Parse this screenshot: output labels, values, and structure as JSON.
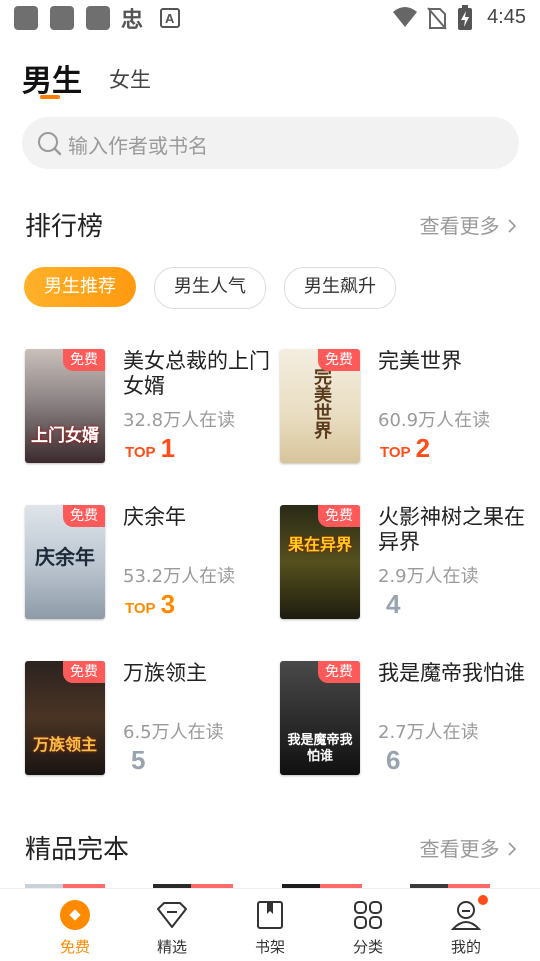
{
  "status_bar": {
    "time": "4:45",
    "app_glyph": "忠",
    "icons": [
      "app-square-icon",
      "app-square-icon",
      "app-square-icon",
      "font-app-icon",
      "wifi-icon",
      "no-sim-icon",
      "battery-charging-icon"
    ]
  },
  "tabs": {
    "male": "男生",
    "female": "女生"
  },
  "search": {
    "placeholder": "输入作者或书名"
  },
  "ranking": {
    "title": "排行榜",
    "more": "查看更多",
    "filters": [
      "男生推荐",
      "男生人气",
      "男生飙升"
    ],
    "books": [
      {
        "title": "美女总裁的上门女婿",
        "readers": "32.8万人在读",
        "top_label": "TOP",
        "rank": "1",
        "badge": "免费",
        "cover_text": "上门女婿",
        "accent": "#ff4d1a"
      },
      {
        "title": "完美世界",
        "readers": "60.9万人在读",
        "top_label": "TOP",
        "rank": "2",
        "badge": "免费",
        "cover_text": "完美世界",
        "accent": "#ff4d1a"
      },
      {
        "title": "庆余年",
        "readers": "53.2万人在读",
        "top_label": "TOP",
        "rank": "3",
        "badge": "免费",
        "cover_text": "庆余年",
        "accent": "#ff8a00"
      },
      {
        "title": "火影神树之果在异界",
        "readers": "2.9万人在读",
        "top_label": "",
        "rank": "4",
        "badge": "免费",
        "cover_text": "果在异界",
        "accent": "#9aa3b0"
      },
      {
        "title": "万族领主",
        "readers": "6.5万人在读",
        "top_label": "",
        "rank": "5",
        "badge": "免费",
        "cover_text": "万族领主",
        "accent": "#9aa3b0"
      },
      {
        "title": "我是魔帝我怕谁",
        "readers": "2.7万人在读",
        "top_label": "",
        "rank": "6",
        "badge": "免费",
        "cover_text": "我是魔帝我怕谁",
        "accent": "#9aa3b0"
      }
    ]
  },
  "completed": {
    "title": "精品完本",
    "more": "查看更多"
  },
  "bottom_nav": [
    {
      "label": "免费",
      "icon": "free-diamond-icon",
      "active": true
    },
    {
      "label": "精选",
      "icon": "featured-gem-icon",
      "active": false
    },
    {
      "label": "书架",
      "icon": "bookshelf-icon",
      "active": false
    },
    {
      "label": "分类",
      "icon": "category-grid-icon",
      "active": false
    },
    {
      "label": "我的",
      "icon": "profile-icon",
      "active": false,
      "notification_dot": true
    }
  ],
  "colors": {
    "accent": "#ff8a00",
    "badge": "#ff5a5a",
    "top_red": "#ff4d1a"
  }
}
